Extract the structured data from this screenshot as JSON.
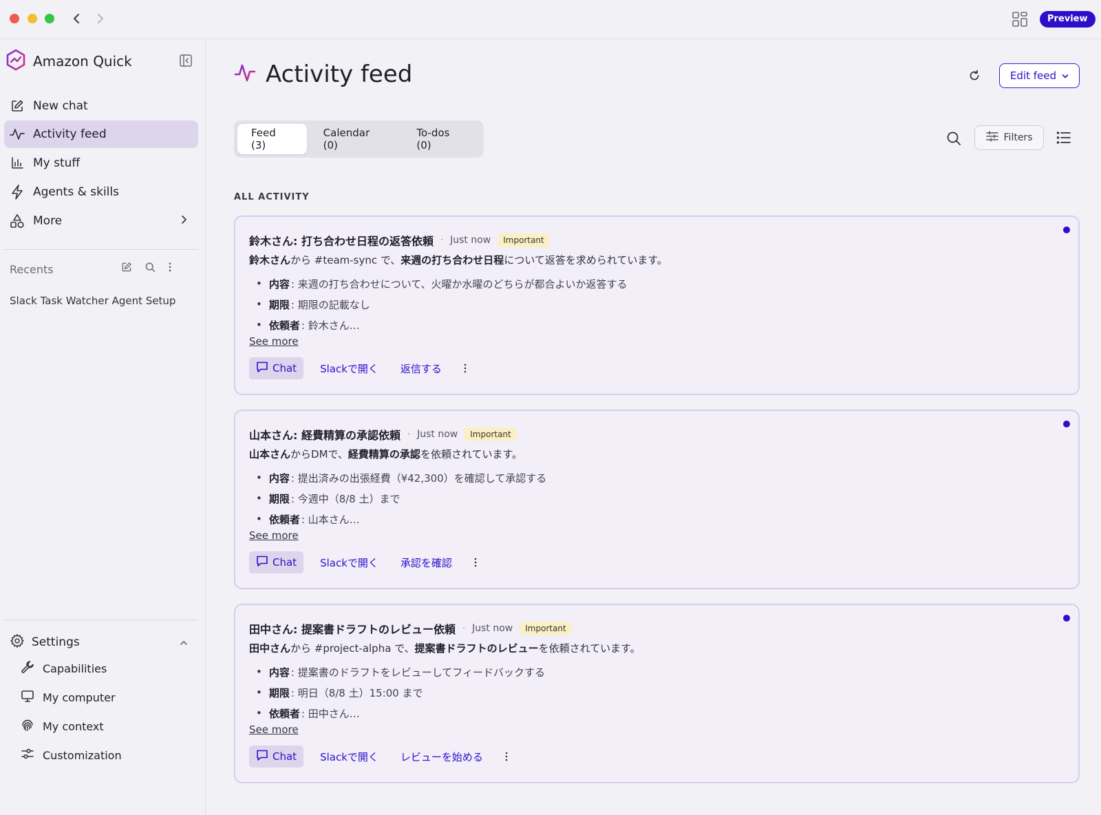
{
  "window": {
    "preview_badge": "Preview"
  },
  "sidebar": {
    "brand": "Amazon Quick",
    "nav": [
      {
        "label": "New chat",
        "icon": "edit-icon"
      },
      {
        "label": "Activity feed",
        "icon": "activity-icon",
        "active": true
      },
      {
        "label": "My stuff",
        "icon": "bar-chart-icon"
      },
      {
        "label": "Agents & skills",
        "icon": "lightning-icon"
      },
      {
        "label": "More",
        "icon": "shapes-icon"
      }
    ],
    "recents_label": "Recents",
    "recents": [
      "Slack Task Watcher Agent Setup"
    ],
    "settings_label": "Settings",
    "settings_items": [
      {
        "label": "Capabilities",
        "icon": "wrench-icon"
      },
      {
        "label": "My computer",
        "icon": "monitor-icon"
      },
      {
        "label": "My context",
        "icon": "fingerprint-icon"
      },
      {
        "label": "Customization",
        "icon": "sliders-icon"
      }
    ]
  },
  "main": {
    "title": "Activity feed",
    "edit_feed_label": "Edit feed",
    "tabs": [
      {
        "label": "Feed (3)",
        "active": true
      },
      {
        "label": "Calendar (0)"
      },
      {
        "label": "To-dos (0)"
      }
    ],
    "filters_label": "Filters",
    "section_label": "ALL ACTIVITY",
    "cards": [
      {
        "title": "鈴木さん: 打ち合わせ日程の返答依頼",
        "time": "Just now",
        "badge": "Important",
        "summary": {
          "p1": "鈴木さん",
          "p2": "から #team-sync で、",
          "p3": "来週の打ち合わせ日程",
          "p4": "について返答を求められています。"
        },
        "items": [
          {
            "k": "内容",
            "v": ": 来週の打ち合わせについて、火曜か水曜のどちらが都合よいか返答する"
          },
          {
            "k": "期限",
            "v": ": 期限の記載なし"
          },
          {
            "k": "依頼者",
            "v": ": 鈴木さん…"
          }
        ],
        "see_more": "See more",
        "chat_label": "Chat",
        "open_slack": "Slackで開く",
        "action": "返信する"
      },
      {
        "title": "山本さん: 経費精算の承認依頼",
        "time": "Just now",
        "badge": "Important",
        "summary": {
          "p1": "山本さん",
          "p2": "からDMで、",
          "p3": "経費精算の承認",
          "p4": "を依頼されています。"
        },
        "items": [
          {
            "k": "内容",
            "v": ": 提出済みの出張経費（¥42,300）を確認して承認する"
          },
          {
            "k": "期限",
            "v": ": 今週中（8/8 土）まで"
          },
          {
            "k": "依頼者",
            "v": ": 山本さん…"
          }
        ],
        "see_more": "See more",
        "chat_label": "Chat",
        "open_slack": "Slackで開く",
        "action": "承認を確認"
      },
      {
        "title": "田中さん: 提案書ドラフトのレビュー依頼",
        "time": "Just now",
        "badge": "Important",
        "summary": {
          "p1": "田中さん",
          "p2": "から #project-alpha で、",
          "p3": "提案書ドラフトのレビュー",
          "p4": "を依頼されています。"
        },
        "items": [
          {
            "k": "内容",
            "v": ": 提案書のドラフトをレビューしてフィードバックする"
          },
          {
            "k": "期限",
            "v": ": 明日（8/8 土）15:00 まで"
          },
          {
            "k": "依頼者",
            "v": ": 田中さん…"
          }
        ],
        "see_more": "See more",
        "chat_label": "Chat",
        "open_slack": "Slackで開く",
        "action": "レビューを始める"
      }
    ]
  },
  "colors": {
    "accent": "#2d0fc9",
    "active_nav": "#dcd5ec",
    "card_bg": "#f2eff9",
    "badge_bg": "#f9f0c8",
    "brand_gradient": [
      "#7b2fd6",
      "#d6337a"
    ]
  }
}
